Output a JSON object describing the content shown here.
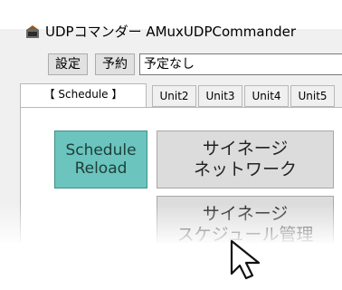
{
  "window": {
    "title": "UDPコマンダー AMuxUDPCommander",
    "icon": "terminal-app-icon"
  },
  "toolbar": {
    "settings_label": "設定",
    "reserve_label": "予約",
    "schedule_field_value": "予定なし"
  },
  "tabs": [
    {
      "label": "【 Schedule 】",
      "active": true
    },
    {
      "label": "Unit2",
      "active": false
    },
    {
      "label": "Unit3",
      "active": false
    },
    {
      "label": "Unit4",
      "active": false
    },
    {
      "label": "Unit5",
      "active": false
    }
  ],
  "panel": {
    "reload_button": {
      "line1": "Schedule",
      "line2": "Reload"
    },
    "network_button": {
      "line1": "サイネージ",
      "line2": "ネットワーク"
    },
    "schedule_manage_button": {
      "line1": "サイネージ",
      "line2": "スケジュール管理"
    }
  },
  "colors": {
    "accent_teal": "#6bc4bd",
    "button_gray": "#dcdcdc"
  },
  "cursor": {
    "icon": "mouse-pointer-icon"
  }
}
